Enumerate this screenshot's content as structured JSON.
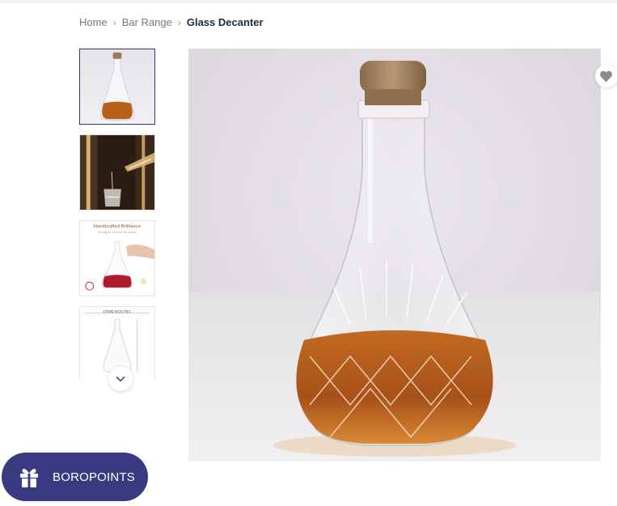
{
  "breadcrumb": {
    "items": [
      "Home",
      "Bar Range"
    ],
    "current": "Glass Decanter",
    "separator": "›"
  },
  "thumbnails": {
    "items": [
      {
        "kind": "product-photo"
      },
      {
        "kind": "pouring-photo"
      },
      {
        "kind": "infographic",
        "title": "Handcrafted Brilliance",
        "subtitle": "Designs etched by hand"
      },
      {
        "kind": "dimensions",
        "title": "DIMENSIONS"
      }
    ],
    "selected_index": 0
  },
  "scroll_button": {
    "icon": "chevron-down-icon"
  },
  "main_image": {
    "alt": "Glass Decanter"
  },
  "wishlist": {
    "icon": "heart-icon"
  },
  "rewards": {
    "label": "BOROPOINTS",
    "icon": "gift-icon"
  },
  "colors": {
    "accent_dark": "#1d2a44",
    "selected_border": "#2b3c6b",
    "rewards_bg": "#3a3a82",
    "liquid": "#b45a14"
  }
}
